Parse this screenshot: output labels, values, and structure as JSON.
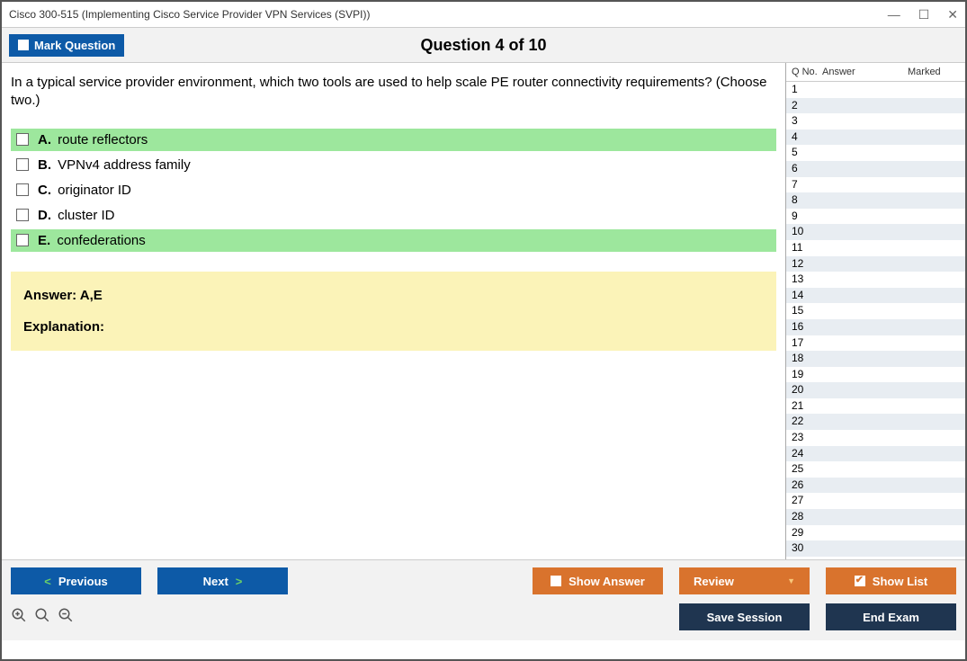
{
  "window": {
    "title": "Cisco 300-515 (Implementing Cisco Service Provider VPN Services (SVPI))"
  },
  "header": {
    "mark_label": "Mark Question",
    "counter": "Question 4 of 10"
  },
  "question": {
    "stem": "In a typical service provider environment, which two tools are used to help scale PE router connectivity requirements? (Choose two.)",
    "choices": [
      {
        "letter": "A.",
        "text": "route reflectors",
        "correct": true
      },
      {
        "letter": "B.",
        "text": "VPNv4 address family",
        "correct": false
      },
      {
        "letter": "C.",
        "text": "originator ID",
        "correct": false
      },
      {
        "letter": "D.",
        "text": "cluster ID",
        "correct": false
      },
      {
        "letter": "E.",
        "text": "confederations",
        "correct": true
      }
    ],
    "answer_label": "Answer: A,E",
    "explanation_label": "Explanation:"
  },
  "sidebar": {
    "col_qno": "Q No.",
    "col_answer": "Answer",
    "col_marked": "Marked",
    "rows": [
      1,
      2,
      3,
      4,
      5,
      6,
      7,
      8,
      9,
      10,
      11,
      12,
      13,
      14,
      15,
      16,
      17,
      18,
      19,
      20,
      21,
      22,
      23,
      24,
      25,
      26,
      27,
      28,
      29,
      30
    ]
  },
  "footer": {
    "previous": "Previous",
    "next": "Next",
    "show_answer": "Show Answer",
    "review": "Review",
    "show_list": "Show List",
    "save_session": "Save Session",
    "end_exam": "End Exam"
  }
}
